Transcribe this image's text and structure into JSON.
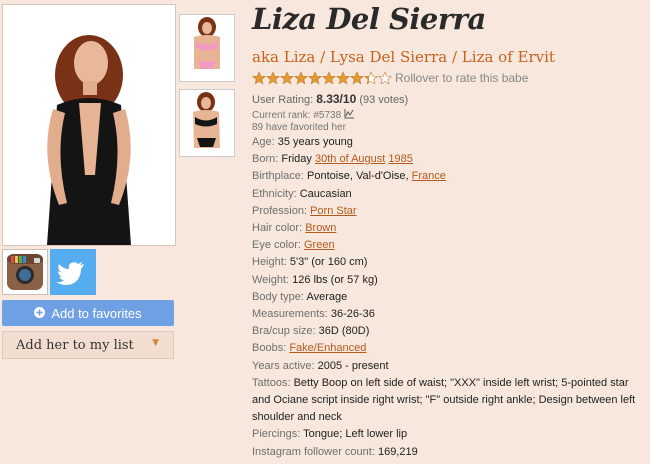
{
  "name": "Liza Del Sierra",
  "aka": "aka Liza / Lysa Del Sierra / Liza of Ervit",
  "rating": {
    "stars_filled": 8.33,
    "stars_total": 10,
    "rollover_text": "Rollover to rate this babe",
    "label": "User Rating:",
    "score": "8.33/10",
    "votes": "(93 votes)"
  },
  "rank": {
    "label": "Current rank:",
    "value": "#5738"
  },
  "favorited": "89 have favorited her",
  "buttons": {
    "add_favorites": "Add to favorites",
    "add_list": "Add her to my list"
  },
  "social": {
    "instagram": "instagram-icon",
    "twitter": "twitter-icon"
  },
  "details": {
    "age": {
      "label": "Age:",
      "value": "35 years young"
    },
    "born": {
      "label": "Born:",
      "prefix": "Friday",
      "date": "30th of August",
      "year": "1985"
    },
    "birthplace": {
      "label": "Birthplace:",
      "city": "Pontoise, Val-d'Oise,",
      "country": "France"
    },
    "ethnicity": {
      "label": "Ethnicity:",
      "value": "Caucasian"
    },
    "profession": {
      "label": "Profession:",
      "value": "Porn Star"
    },
    "hair": {
      "label": "Hair color:",
      "value": "Brown"
    },
    "eyes": {
      "label": "Eye color:",
      "value": "Green"
    },
    "height": {
      "label": "Height:",
      "value": "5'3\" (or 160 cm)"
    },
    "weight": {
      "label": "Weight:",
      "value": "126 lbs (or 57 kg)"
    },
    "body": {
      "label": "Body type:",
      "value": "Average"
    },
    "measurements": {
      "label": "Measurements:",
      "value": "36-26-36"
    },
    "bra": {
      "label": "Bra/cup size:",
      "value": "36D (80D)"
    },
    "boobs": {
      "label": "Boobs:",
      "value": "Fake/Enhanced"
    },
    "years_active": {
      "label": "Years active:",
      "value": "2005 - present"
    },
    "tattoos": {
      "label": "Tattoos:",
      "value": "Betty Boop on left side of waist; \"XXX\" inside left wrist; 5-pointed star and Ociane script inside right wrist; \"F\" outside right ankle; Design between left shoulder and neck"
    },
    "piercings": {
      "label": "Piercings:",
      "value": "Tongue; Left lower lip"
    },
    "instagram": {
      "label": "Instagram follower count:",
      "value": "169,219"
    }
  },
  "colors": {
    "background": "#f7e7dc",
    "accent": "#c8611d",
    "button": "#6fa0e4",
    "star": "#e39a36"
  }
}
